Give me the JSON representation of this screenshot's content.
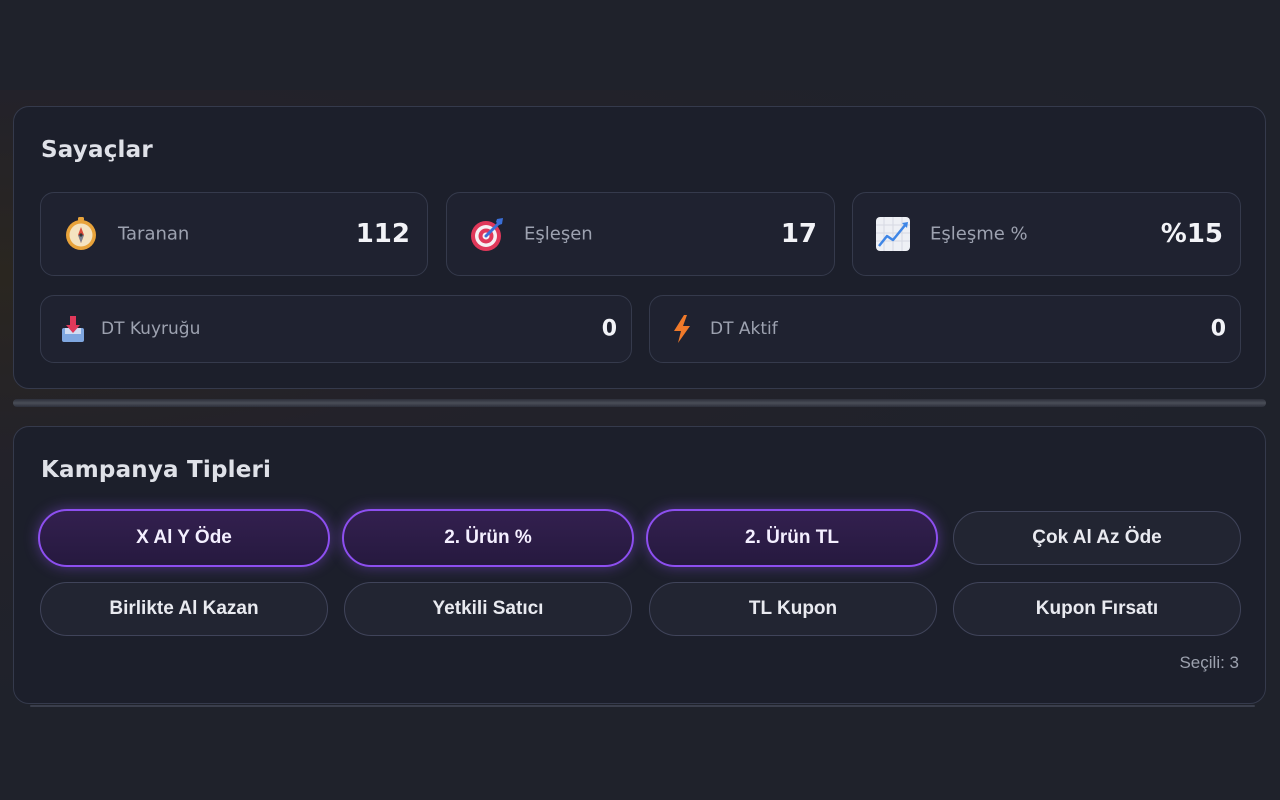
{
  "counters": {
    "title": "Sayaçlar",
    "stats": [
      {
        "label": "Taranan",
        "value": "112",
        "icon": "compass-icon"
      },
      {
        "label": "Eşleşen",
        "value": "17",
        "icon": "target-icon"
      },
      {
        "label": "Eşleşme %",
        "value": "%15",
        "icon": "chart-increasing-icon"
      },
      {
        "label": "DT Kuyruğu",
        "value": "0",
        "icon": "inbox-tray-icon"
      },
      {
        "label": "DT Aktif",
        "value": "0",
        "icon": "lightning-icon"
      }
    ]
  },
  "campaigns": {
    "title": "Kampanya Tipleri",
    "chips": [
      {
        "label": "X Al Y Öde",
        "selected": true
      },
      {
        "label": "2. Ürün %",
        "selected": true
      },
      {
        "label": "2. Ürün TL",
        "selected": true
      },
      {
        "label": "Çok Al Az Öde",
        "selected": false
      },
      {
        "label": "Birlikte Al Kazan",
        "selected": false
      },
      {
        "label": "Yetkili Satıcı",
        "selected": false
      },
      {
        "label": "TL Kupon",
        "selected": false
      },
      {
        "label": "Kupon Fırsatı",
        "selected": false
      }
    ],
    "selected_text": "Seçili: 3"
  },
  "colors": {
    "accent": "#8d4ff0",
    "card_bg": "#1c1f2b",
    "page_bg": "#1f222b"
  }
}
